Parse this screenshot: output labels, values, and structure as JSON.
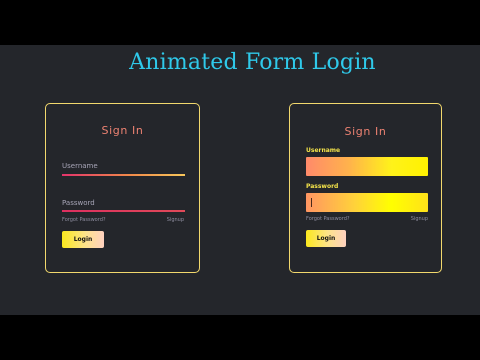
{
  "page_title": "Animated Form Login",
  "left_form": {
    "title": "Sign In",
    "username_placeholder": "Username",
    "password_placeholder": "Password",
    "forgot_link": "Forgot Password?",
    "signup_link": "Signup",
    "login_label": "Login"
  },
  "right_form": {
    "title": "Sign In",
    "username_label": "Username",
    "password_label": "Password",
    "forgot_link": "Forgot Password?",
    "signup_link": "Signup",
    "login_label": "Login"
  },
  "colors": {
    "stage_bg": "#24262b",
    "title_blue": "#2fc9ea",
    "card_border": "#f2d86d",
    "sign_in_title": "#ec8272",
    "label_yellow": "#f5e44a"
  }
}
